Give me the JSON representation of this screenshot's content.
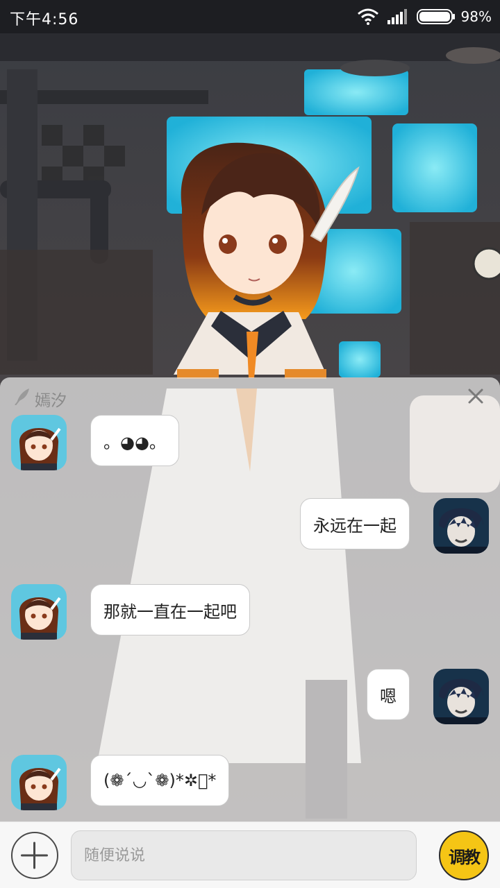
{
  "status_bar": {
    "time": "下午4:56",
    "battery": "98%",
    "icons": [
      "wifi-icon",
      "signal-icon",
      "battery-icon"
    ]
  },
  "chat": {
    "contact_name": "嫣汐",
    "messages": [
      {
        "side": "left",
        "text": "。◕◕。"
      },
      {
        "side": "right",
        "text": "永远在一起"
      },
      {
        "side": "left",
        "text": "那就一直在一起吧"
      },
      {
        "side": "right",
        "text": "嗯"
      },
      {
        "side": "left",
        "text": "(❁´◡`❁)*✲ﾟ*"
      }
    ]
  },
  "input_bar": {
    "placeholder": "随便说说",
    "train_button_label": "调教"
  },
  "colors": {
    "status_bar_bg": "#1d1e22",
    "panel_bg": "#ececec",
    "bubble_bg": "#ffffff",
    "train_button": "#f5c515",
    "screen_glow": "#4fe3ff"
  }
}
